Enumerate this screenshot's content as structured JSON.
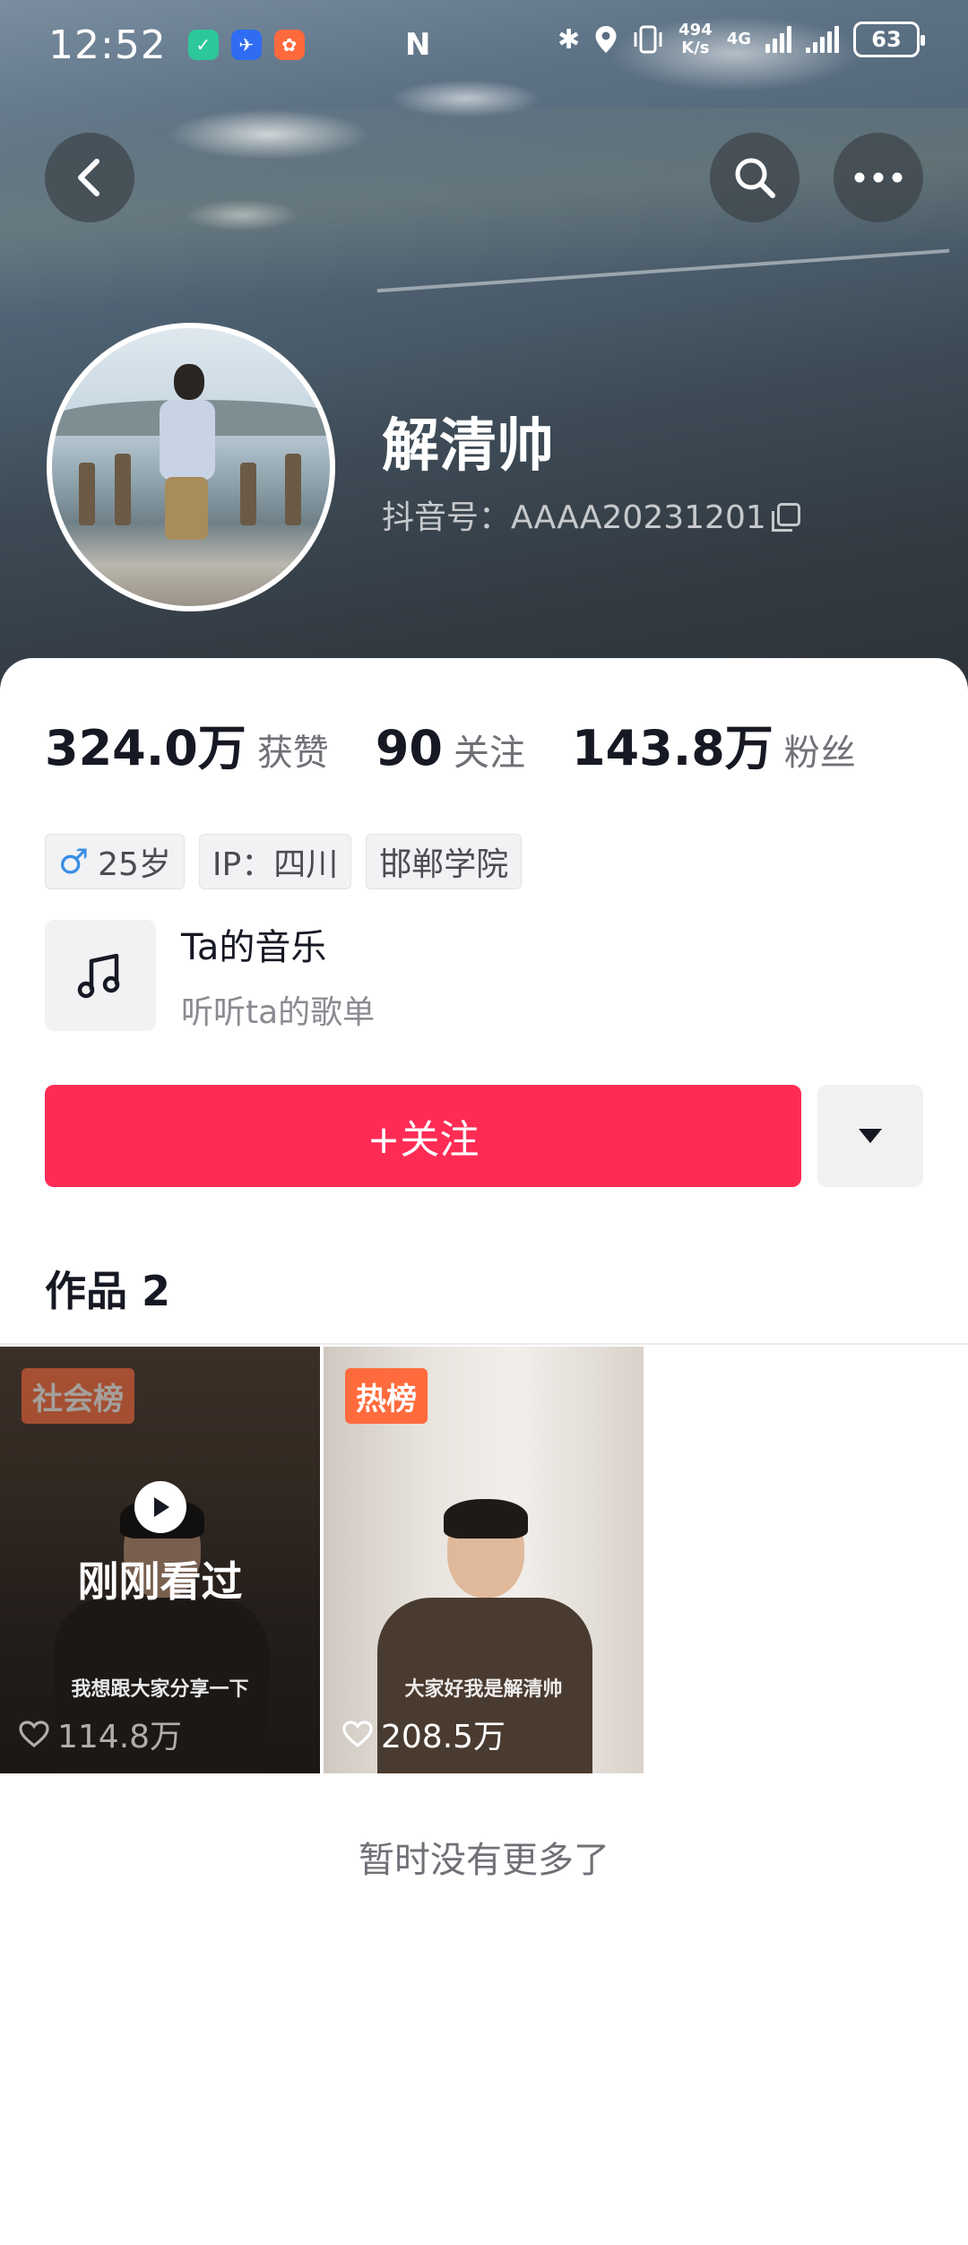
{
  "status_bar": {
    "time": "12:52",
    "speed_value": "494",
    "speed_unit": "K/s",
    "network": "4G",
    "battery": "63"
  },
  "profile": {
    "name": "解清帅",
    "id_text": "抖音号：AAAA20231201"
  },
  "stats": [
    {
      "value": "324.0万",
      "label": "获赞"
    },
    {
      "value": "90",
      "label": "关注"
    },
    {
      "value": "143.8万",
      "label": "粉丝"
    }
  ],
  "tags": {
    "age": "25岁",
    "ip": "IP：四川",
    "school": "邯郸学院"
  },
  "music": {
    "title": "Ta的音乐",
    "subtitle": "听听ta的歌单"
  },
  "follow_button": "+关注",
  "works": {
    "title": "作品 2",
    "videos": [
      {
        "badge": "社会榜",
        "caption": "我想跟大家分享一下",
        "likes": "114.8万",
        "overlay": "刚刚看过"
      },
      {
        "badge": "热榜",
        "caption": "大家好我是解清帅",
        "likes": "208.5万"
      }
    ]
  },
  "footer_text": "暂时没有更多了",
  "colors": {
    "primary": "#fe2c55",
    "badge": "#ff6b3d",
    "male": "#3a8ee6"
  }
}
